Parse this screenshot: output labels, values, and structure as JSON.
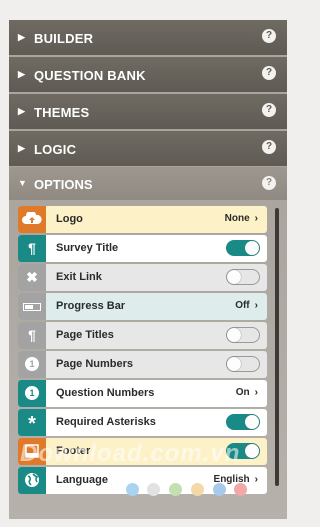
{
  "sections": [
    {
      "label": "BUILDER",
      "help": "?"
    },
    {
      "label": "QUESTION BANK",
      "help": "?"
    },
    {
      "label": "THEMES",
      "help": "?"
    },
    {
      "label": "LOGIC",
      "help": "?"
    }
  ],
  "options": {
    "label": "OPTIONS",
    "help": "?",
    "items": [
      {
        "label": "Logo",
        "value": "None",
        "icon": "logo-upload-icon",
        "state": "value"
      },
      {
        "label": "Survey Title",
        "icon": "paragraph-icon",
        "state": "on"
      },
      {
        "label": "Exit Link",
        "icon": "close-x-icon",
        "state": "off"
      },
      {
        "label": "Progress Bar",
        "value": "Off",
        "icon": "progress-bar-icon",
        "state": "value"
      },
      {
        "label": "Page Titles",
        "icon": "paragraph-icon",
        "state": "off"
      },
      {
        "label": "Page Numbers",
        "icon": "number-circle-icon",
        "state": "off"
      },
      {
        "label": "Question Numbers",
        "value": "On",
        "icon": "number-circle-icon",
        "state": "value"
      },
      {
        "label": "Required Asterisks",
        "icon": "asterisk-icon",
        "state": "on"
      },
      {
        "label": "Footer",
        "icon": "footer-icon",
        "state": "on"
      },
      {
        "label": "Language",
        "value": "English",
        "icon": "globe-icon",
        "state": "value"
      }
    ]
  },
  "icon_glyphs": {
    "arrow_right": "▶",
    "arrow_down": "▼",
    "chevron": "›",
    "paragraph": "¶",
    "x": "✖",
    "number": "1",
    "asterisk": "*",
    "globe": "◍"
  },
  "watermark": "Download.com.vn",
  "colors": {
    "teal": "#1a8a86",
    "orange": "#e07a2b",
    "gray_icon": "#9c9c9c",
    "cream": "#fdf1c7",
    "light_blue": "#dfecec"
  }
}
